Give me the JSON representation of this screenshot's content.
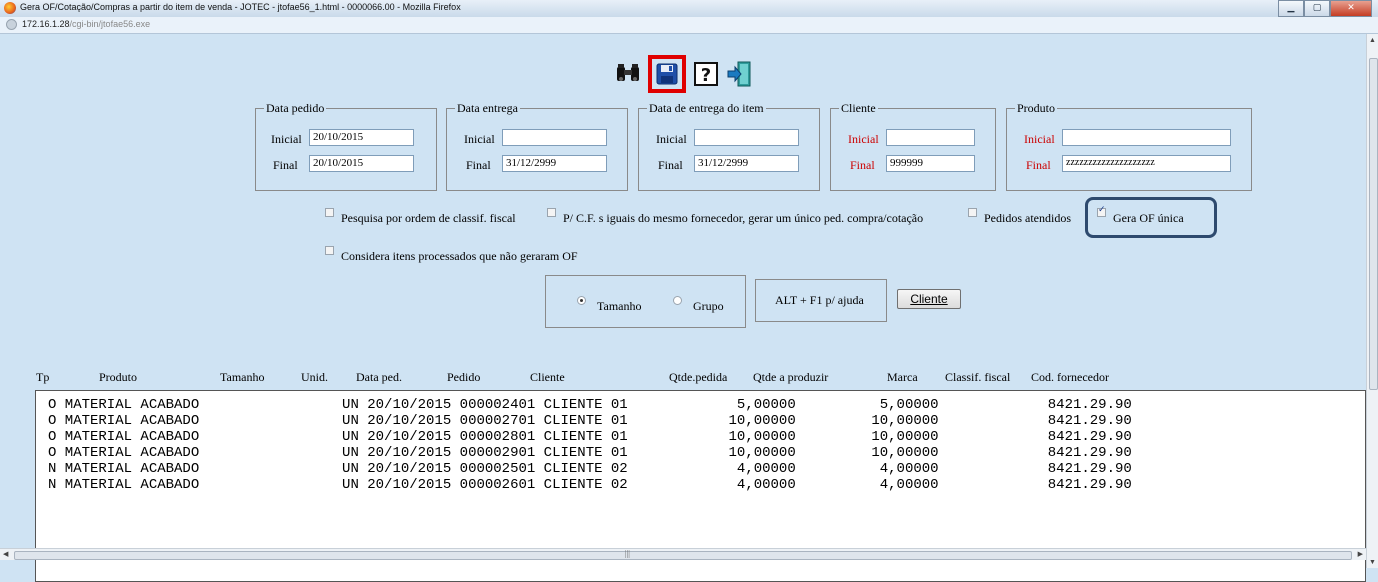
{
  "window": {
    "title": "Gera OF/Cotação/Compras a partir do item de venda - JOTEC - jtofae56_1.html - 0000066.00 - Mozilla Firefox",
    "url_host": "172.16.1.28",
    "url_path": "/cgi-bin/jtofae56.exe"
  },
  "toolbar": {
    "icons": [
      "binoculars-icon",
      "save-icon",
      "help-icon",
      "exit-icon"
    ],
    "save_highlight_color": "#e00000"
  },
  "filters": {
    "data_pedido": {
      "legend": "Data pedido",
      "inicial_label": "Inicial",
      "inicial_value": "20/10/2015",
      "final_label": "Final",
      "final_value": "20/10/2015"
    },
    "data_entrega": {
      "legend": "Data entrega",
      "inicial_label": "Inicial",
      "inicial_value": "",
      "final_label": "Final",
      "final_value": "31/12/2999"
    },
    "data_entrega_item": {
      "legend": "Data de entrega do item",
      "inicial_label": "Inicial",
      "inicial_value": "",
      "final_label": "Final",
      "final_value": "31/12/2999"
    },
    "cliente": {
      "legend": "Cliente",
      "inicial_label": "Inicial",
      "inicial_value": "",
      "final_label": "Final",
      "final_value": "999999"
    },
    "produto": {
      "legend": "Produto",
      "inicial_label": "Inicial",
      "inicial_value": "",
      "final_label": "Final",
      "final_value": "zzzzzzzzzzzzzzzzzzzz"
    }
  },
  "options": {
    "pesquisa_classif": {
      "label": "Pesquisa por ordem de classif. fiscal",
      "checked": false
    },
    "pc_iguais": {
      "label": "P/ C.F. s iguais do mesmo fornecedor, gerar um único ped. compra/cotação",
      "checked": false
    },
    "pedidos_atendidos": {
      "label": "Pedidos atendidos",
      "checked": false
    },
    "gera_of_unica": {
      "label": "Gera OF única",
      "checked": true
    },
    "considera_itens": {
      "label": "Considera itens processados que não geraram OF",
      "checked": false
    }
  },
  "grouping": {
    "tamanho_label": "Tamanho",
    "grupo_label": "Grupo",
    "selected": "Tamanho",
    "help_text": "ALT + F1 p/ ajuda",
    "cliente_button": "Cliente"
  },
  "table": {
    "headers": [
      "Tp",
      "Produto",
      "Tamanho",
      "Unid.",
      "Data ped.",
      "Pedido",
      "Cliente",
      "Qtde.pedida",
      "Qtde a produzir",
      "Marca",
      "Classif. fiscal",
      "Cod. fornecedor"
    ],
    "rows": [
      "O MATERIAL ACABADO                 UN 20/10/2015 000002401 CLIENTE 01             5,00000          5,00000             8421.29.90",
      "O MATERIAL ACABADO                 UN 20/10/2015 000002701 CLIENTE 01            10,00000         10,00000             8421.29.90",
      "O MATERIAL ACABADO                 UN 20/10/2015 000002801 CLIENTE 01            10,00000         10,00000             8421.29.90",
      "O MATERIAL ACABADO                 UN 20/10/2015 000002901 CLIENTE 01            10,00000         10,00000             8421.29.90",
      "N MATERIAL ACABADO                 UN 20/10/2015 000002501 CLIENTE 02             4,00000          4,00000             8421.29.90",
      "N MATERIAL ACABADO                 UN 20/10/2015 000002601 CLIENTE 02             4,00000          4,00000             8421.29.90"
    ]
  },
  "scrollbar": {
    "grip": "|||"
  }
}
